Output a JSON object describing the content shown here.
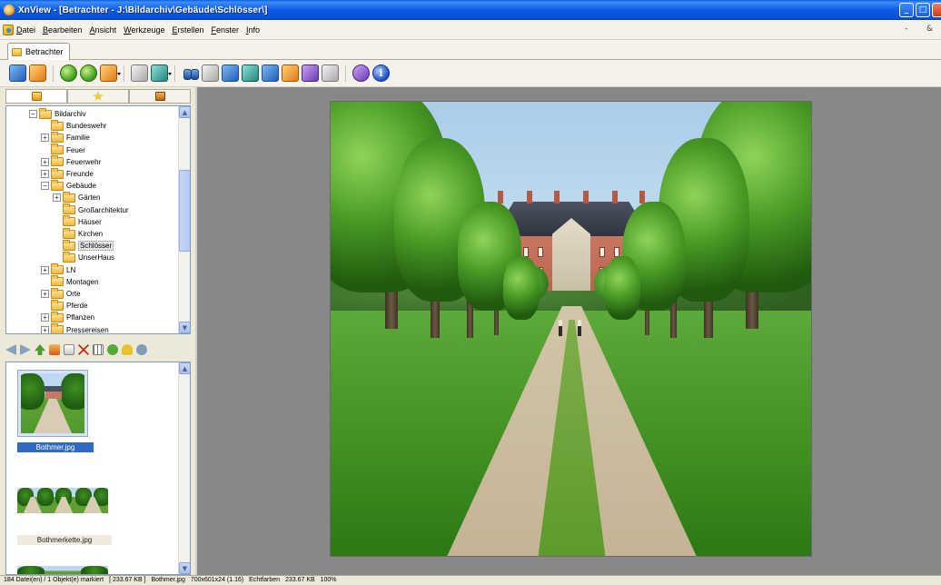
{
  "window": {
    "title": "XnView - [Betrachter - J:\\Bildarchiv\\Gebäude\\Schlösser\\]"
  },
  "menu": {
    "items": [
      {
        "key": "D",
        "rest": "atei"
      },
      {
        "key": "B",
        "rest": "earbeiten"
      },
      {
        "key": "A",
        "rest": "nsicht"
      },
      {
        "key": "W",
        "rest": "erkzeuge"
      },
      {
        "key": "E",
        "rest": "rstellen"
      },
      {
        "key": "F",
        "rest": "enster"
      },
      {
        "key": "I",
        "rest": "nfo"
      }
    ],
    "right_controls": "-   &"
  },
  "tabs": [
    {
      "label": "Betrachter"
    }
  ],
  "folder_tree": {
    "items": [
      {
        "label": "Bildarchiv",
        "depth": 0,
        "expander": "−"
      },
      {
        "label": "Bundeswehr",
        "depth": 1,
        "expander": ""
      },
      {
        "label": "Familie",
        "depth": 1,
        "expander": "+"
      },
      {
        "label": "Feuer",
        "depth": 1,
        "expander": ""
      },
      {
        "label": "Feuerwehr",
        "depth": 1,
        "expander": "+"
      },
      {
        "label": "Freunde",
        "depth": 1,
        "expander": "+"
      },
      {
        "label": "Gebäude",
        "depth": 1,
        "expander": "−"
      },
      {
        "label": "Gärten",
        "depth": 2,
        "expander": "+"
      },
      {
        "label": "Großarchitektur",
        "depth": 2,
        "expander": ""
      },
      {
        "label": "Häuser",
        "depth": 2,
        "expander": ""
      },
      {
        "label": "Kirchen",
        "depth": 2,
        "expander": ""
      },
      {
        "label": "Schlösser",
        "depth": 2,
        "expander": "",
        "selected": true
      },
      {
        "label": "UnserHaus",
        "depth": 2,
        "expander": ""
      },
      {
        "label": "LN",
        "depth": 1,
        "expander": "+"
      },
      {
        "label": "Montagen",
        "depth": 1,
        "expander": ""
      },
      {
        "label": "Orte",
        "depth": 1,
        "expander": "+"
      },
      {
        "label": "Pferde",
        "depth": 1,
        "expander": ""
      },
      {
        "label": "Pflanzen",
        "depth": 1,
        "expander": "+"
      },
      {
        "label": "Pressereisen",
        "depth": 1,
        "expander": "+"
      }
    ]
  },
  "thumbnails": [
    {
      "filename": "Bothmer.jpg",
      "selected": true
    },
    {
      "filename": "Bothmerkette.jpg",
      "selected": false
    }
  ],
  "statusbar": {
    "files": "184 Datei(en) / 1 Objekt(e) markiert",
    "size": "[ 233.67 KB ]",
    "current_file": "Bothmer.jpg",
    "dimensions": "700x601x24 (1.16)",
    "color_mode": "Echtfarben",
    "file_size": "233.67 KB",
    "zoom": "100%"
  },
  "icons": {
    "app": "xnview-app-icon",
    "toolbar": [
      "browse-icon",
      "fullscreen-icon",
      "back-icon",
      "forward-icon",
      "folder-up-icon",
      "copy-icon",
      "move-icon",
      "find-icon",
      "print-icon",
      "scanner-icon",
      "slideshow-icon",
      "convert-icon",
      "webpage-icon",
      "screenshot-icon",
      "settings-icon",
      "info-icon"
    ]
  },
  "colors": {
    "titlebar": "#0a5fe0",
    "selection": "#316ac5",
    "viewer_bg": "#888888"
  }
}
